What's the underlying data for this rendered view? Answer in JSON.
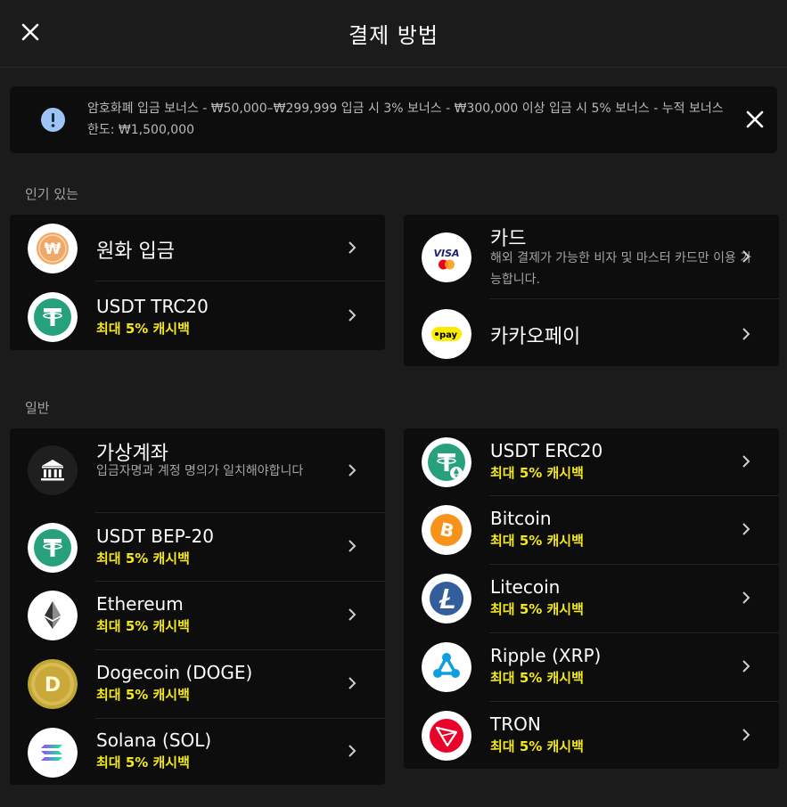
{
  "header": {
    "title": "결제 방법",
    "close_icon": "close-icon"
  },
  "notice": {
    "text": "암호화폐 입금 보너스 - ₩50,000–₩299,999 입금 시 3% 보너스 - ₩300,000 이상 입금 시 5% 보너스 - 누적 보너스 한도: ₩1,500,000",
    "info_color": "#9ec3f5"
  },
  "popular": {
    "label": "인기 있는",
    "left": [
      {
        "name": "원화 입금",
        "icon": "won-coin-icon"
      },
      {
        "name": "USDT TRC20",
        "sub": "최대 5% 캐시백",
        "icon": "tether-icon"
      }
    ],
    "right": [
      {
        "name": "카드",
        "desc": "해외 결제가 가능한 비자 및 마스터 카드만 이용 가능합니다.",
        "icon": "visa-mastercard-icon",
        "visa_text": "VISA"
      },
      {
        "name": "카카오페이",
        "icon": "kakaopay-icon",
        "pay_text": "pay"
      }
    ]
  },
  "general": {
    "label": "일반",
    "left": [
      {
        "name": "가상계좌",
        "desc": "입금자명과 계정 명의가 일치해야합니다",
        "icon": "bank-icon"
      },
      {
        "name": "USDT BEP-20",
        "sub": "최대 5% 캐시백",
        "icon": "tether-icon"
      },
      {
        "name": "Ethereum",
        "sub": "최대 5% 캐시백",
        "icon": "ethereum-icon"
      },
      {
        "name": "Dogecoin (DOGE)",
        "sub": "최대 5% 캐시백",
        "icon": "dogecoin-icon"
      },
      {
        "name": "Solana (SOL)",
        "sub": "최대 5% 캐시백",
        "icon": "solana-icon"
      }
    ],
    "right": [
      {
        "name": "USDT ERC20",
        "sub": "최대 5% 캐시백",
        "icon": "tether-erc20-icon"
      },
      {
        "name": "Bitcoin",
        "sub": "최대 5% 캐시백",
        "icon": "bitcoin-icon"
      },
      {
        "name": "Litecoin",
        "sub": "최대 5% 캐시백",
        "icon": "litecoin-icon"
      },
      {
        "name": "Ripple (XRP)",
        "sub": "최대 5% 캐시백",
        "icon": "ripple-icon"
      },
      {
        "name": "TRON",
        "sub": "최대 5% 캐시백",
        "icon": "tron-icon"
      }
    ]
  },
  "colors": {
    "accent_yellow": "#f3e81d",
    "background": "#1b1b1b",
    "card": "#0d0d0d"
  }
}
